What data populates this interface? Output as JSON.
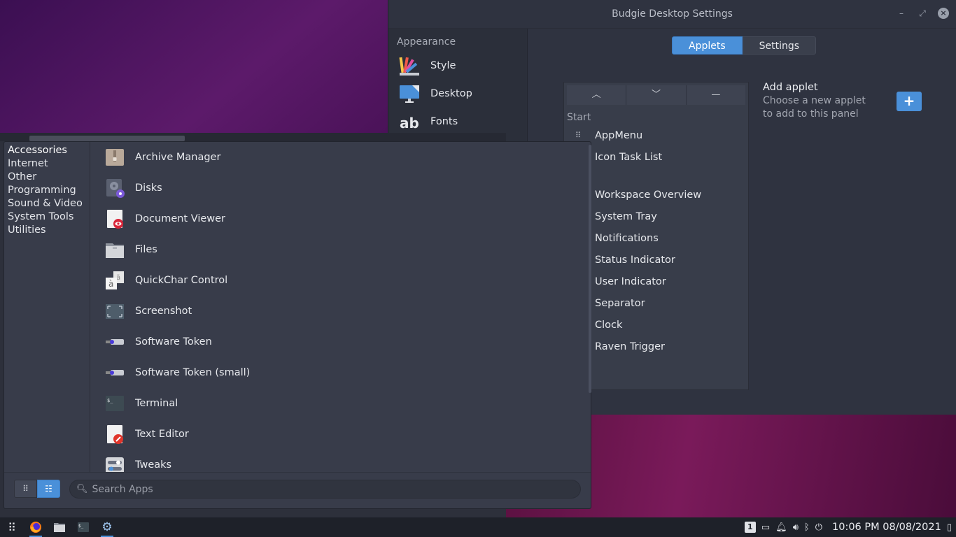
{
  "settings_window": {
    "title": "Budgie Desktop Settings",
    "sidebar": {
      "heading": "Appearance",
      "items": [
        {
          "label": "Style",
          "icon": "style-icon"
        },
        {
          "label": "Desktop",
          "icon": "desktop-icon"
        },
        {
          "label": "Fonts",
          "icon": "fonts-icon"
        }
      ]
    },
    "tabs": {
      "applets": "Applets",
      "settings": "Settings"
    },
    "applet_list": {
      "section": "Start",
      "items": [
        "AppMenu",
        "Icon Task List",
        "",
        "Workspace Overview",
        "System Tray",
        "Notifications",
        "Status Indicator",
        "User Indicator",
        "Separator",
        "Clock",
        "Raven Trigger"
      ]
    },
    "add_applet": {
      "heading": "Add applet",
      "description": "Choose a new applet to add to this panel",
      "button": "+"
    }
  },
  "app_menu": {
    "categories": [
      "Accessories",
      "Internet",
      "Other",
      "Programming",
      "Sound & Video",
      "System Tools",
      "Utilities"
    ],
    "apps": [
      "Archive Manager",
      "Disks",
      "Document Viewer",
      "Files",
      "QuickChar Control",
      "Screenshot",
      "Software Token",
      "Software Token (small)",
      "Terminal",
      "Text Editor",
      "Tweaks"
    ],
    "search_placeholder": "Search Apps"
  },
  "panel": {
    "workspace": "1",
    "clock": "10:06 PM  08/08/2021"
  },
  "colors": {
    "accent": "#4a90d9",
    "window_bg": "#2f3340",
    "menu_bg": "#383c4a",
    "panel_bg": "#1e2129"
  }
}
